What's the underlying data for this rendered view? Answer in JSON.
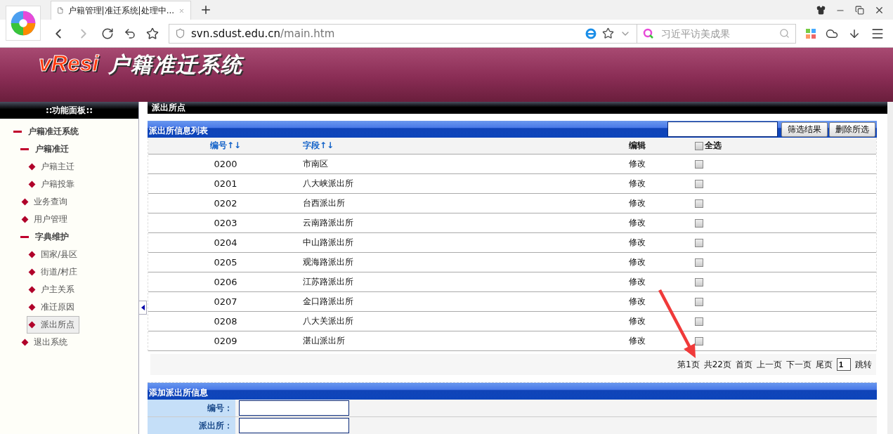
{
  "browser": {
    "tab_title": "户籍管理|准迁系统|处理中...",
    "url_host": "svn.sdust.edu.cn",
    "url_path": "/main.htm",
    "search_placeholder": "习近平访美成果"
  },
  "banner": {
    "logo": "vResi",
    "title": "户籍准迁系统"
  },
  "sidebar": {
    "title": "::功能面板::",
    "items": [
      {
        "label": "户籍准迁系统",
        "expanded": true,
        "selected": false,
        "children": [
          {
            "label": "户籍准迁",
            "expanded": true,
            "selected": false,
            "children": [
              {
                "label": "户籍主迁",
                "selected": false
              },
              {
                "label": "户籍投靠",
                "selected": false
              }
            ]
          },
          {
            "label": "业务查询",
            "selected": false
          },
          {
            "label": "用户管理",
            "selected": false
          },
          {
            "label": "字典维护",
            "expanded": true,
            "selected": false,
            "children": [
              {
                "label": "国家/县区",
                "selected": false
              },
              {
                "label": "街道/村庄",
                "selected": false
              },
              {
                "label": "户主关系",
                "selected": false
              },
              {
                "label": "准迁原因",
                "selected": false
              },
              {
                "label": "派出所点",
                "selected": true
              }
            ]
          },
          {
            "label": "退出系统",
            "selected": false
          }
        ]
      }
    ]
  },
  "main": {
    "title": "派出所点",
    "list": {
      "title": "派出所信息列表",
      "buttons": [
        "筛选结果",
        "删除所选"
      ],
      "columns": [
        {
          "label": "编号",
          "sort": "↑↓"
        },
        {
          "label": "字段",
          "sort": "↑↓"
        },
        {
          "label": "编辑"
        },
        {
          "label": "全选",
          "checked": false
        }
      ],
      "rows": [
        {
          "code": "0200",
          "name": "市南区",
          "edit": "修改",
          "checked": false
        },
        {
          "code": "0201",
          "name": "八大峡派出所",
          "edit": "修改",
          "checked": false
        },
        {
          "code": "0202",
          "name": "台西派出所",
          "edit": "修改",
          "checked": false
        },
        {
          "code": "0203",
          "name": "云南路派出所",
          "edit": "修改",
          "checked": false
        },
        {
          "code": "0204",
          "name": "中山路派出所",
          "edit": "修改",
          "checked": false
        },
        {
          "code": "0205",
          "name": "观海路派出所",
          "edit": "修改",
          "checked": false
        },
        {
          "code": "0206",
          "name": "江苏路派出所",
          "edit": "修改",
          "checked": false
        },
        {
          "code": "0207",
          "name": "金口路派出所",
          "edit": "修改",
          "checked": false
        },
        {
          "code": "0208",
          "name": "八大关派出所",
          "edit": "修改",
          "checked": false
        },
        {
          "code": "0209",
          "name": "湛山派出所",
          "edit": "修改",
          "checked": false
        }
      ],
      "pagination": {
        "current": "第1页",
        "total": "共22页",
        "links": [
          "首页",
          "上一页",
          "下一页",
          "尾页"
        ],
        "page_value": "1",
        "jump": "跳转"
      }
    },
    "form": {
      "title": "添加派出所信息",
      "fields": [
        {
          "label": "编号："
        },
        {
          "label": "派出所："
        }
      ]
    }
  }
}
